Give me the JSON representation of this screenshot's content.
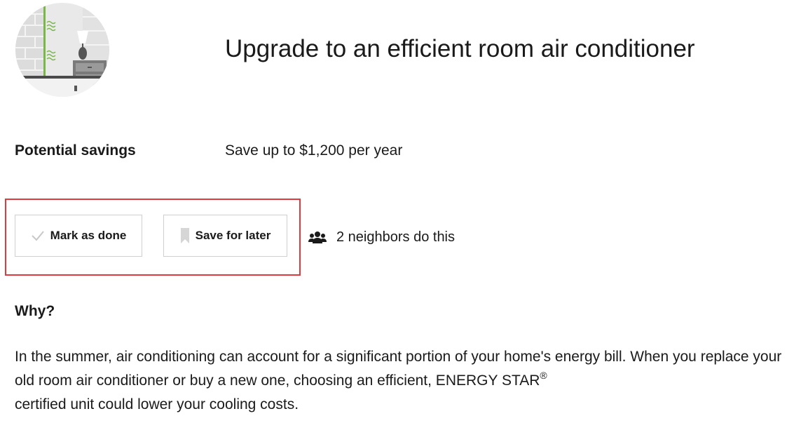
{
  "recommendation": {
    "title": "Upgrade to an efficient room air conditioner",
    "illustration_icon": "room-ac-illustration",
    "savings_label": "Potential savings",
    "savings_value": "Save up to $1,200 per year"
  },
  "actions": {
    "mark_done_label": "Mark as done",
    "mark_done_icon": "checkmark-icon",
    "save_later_label": "Save for later",
    "save_later_icon": "bookmark-icon"
  },
  "social": {
    "icon": "people-icon",
    "text": "2 neighbors do this"
  },
  "why": {
    "heading": "Why?",
    "body_part1": "In the summer, air conditioning can account for a significant portion of your home's energy bill. When you replace your old room air conditioner or buy a new one, choosing an efficient, ENERGY STAR",
    "body_sup": "®",
    "body_part2": " certified unit could lower your cooling costs."
  },
  "colors": {
    "highlight_border": "#e0393e",
    "accent_green": "#7ab648",
    "text": "#1a1a1a",
    "button_border": "#cfcfcf"
  }
}
